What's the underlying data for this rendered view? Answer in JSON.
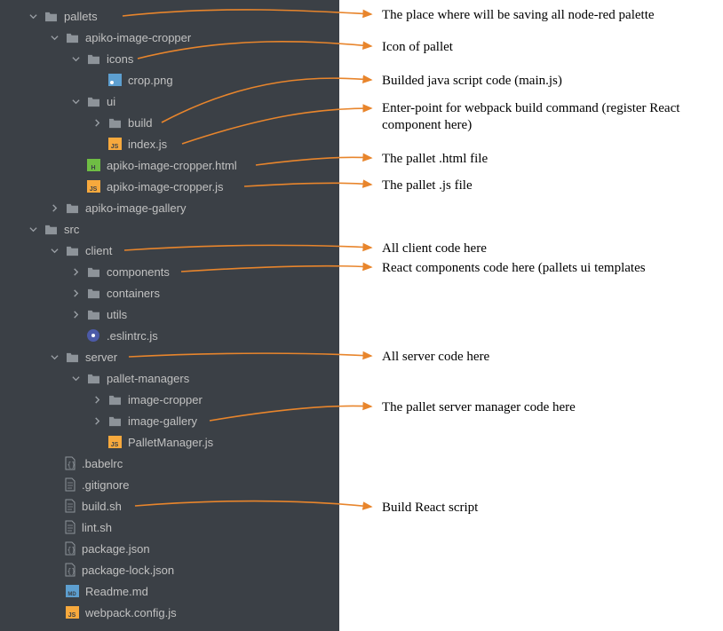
{
  "tree": {
    "pallets": "pallets",
    "apiko_image_cropper": "apiko-image-cropper",
    "icons": "icons",
    "crop_png": "crop.png",
    "ui": "ui",
    "build": "build",
    "index_js": "index.js",
    "cropper_html": "apiko-image-cropper.html",
    "cropper_js": "apiko-image-cropper.js",
    "apiko_image_gallery": "apiko-image-gallery",
    "src": "src",
    "client": "client",
    "components": "components",
    "containers": "containers",
    "utils": "utils",
    "eslintrc": ".eslintrc.js",
    "server": "server",
    "pallet_managers": "pallet-managers",
    "image_cropper": "image-cropper",
    "image_gallery": "image-gallery",
    "PalletManager": "PalletManager.js",
    "babelrc": ".babelrc",
    "gitignore": ".gitignore",
    "build_sh": "build.sh",
    "lint_sh": "lint.sh",
    "package_json": "package.json",
    "package_lock": "package-lock.json",
    "readme": "Readme.md",
    "webpack": "webpack.config.js"
  },
  "annotations": {
    "pallets_desc": "The place where will be saving all node-red palette",
    "icons_desc": "Icon of pallet",
    "build_desc": "Builded java script code (main.js)",
    "index_desc": "Enter-point for webpack build command (register React component here)",
    "html_desc": "The pallet .html file",
    "js_desc": "The pallet .js file",
    "client_desc": "All client code here",
    "components_desc": "React components code here  (pallets ui templates",
    "server_desc": "All server code here",
    "imagegallery_desc": "The pallet server manager code here",
    "buildsh_desc": "Build React script"
  }
}
